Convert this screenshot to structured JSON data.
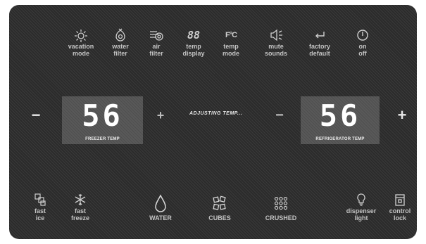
{
  "top_controls": [
    {
      "id": "vacation_mode",
      "lines": [
        "vacation",
        "mode"
      ],
      "icon": "sun-icon"
    },
    {
      "id": "water_filter",
      "lines": [
        "water",
        "filter"
      ],
      "icon": "water-filter-icon"
    },
    {
      "id": "air_filter",
      "lines": [
        "air",
        "filter"
      ],
      "icon": "air-filter-icon"
    },
    {
      "id": "temp_display",
      "lines": [
        "temp",
        "display"
      ],
      "icon": "88"
    },
    {
      "id": "temp_mode",
      "lines": [
        "temp",
        "mode"
      ],
      "icon": "F°C"
    },
    {
      "id": "mute_sounds",
      "lines": [
        "mute",
        "sounds"
      ],
      "icon": "speaker-icon"
    },
    {
      "id": "factory_default",
      "lines": [
        "factory",
        "default"
      ],
      "icon": "return-arrow-icon"
    },
    {
      "id": "on_off",
      "lines": [
        "on",
        "off"
      ],
      "icon": "power-icon"
    }
  ],
  "freezer": {
    "minus": "−",
    "plus": "+",
    "temp": "56",
    "caption": "FREEZER TEMP"
  },
  "refrigerator": {
    "minus": "−",
    "plus": "+",
    "temp": "56",
    "caption": "REFRIGERATOR TEMP"
  },
  "status_text": "ADJUSTING TEMP...",
  "bottom_controls": [
    {
      "id": "fast_ice",
      "lines": [
        "fast",
        "ice"
      ],
      "icon": "ice-cubes-icon"
    },
    {
      "id": "fast_freeze",
      "lines": [
        "fast",
        "freeze"
      ],
      "icon": "snowflake-icon"
    },
    {
      "id": "water",
      "lines": [
        "WATER"
      ],
      "icon": "water-drop-icon"
    },
    {
      "id": "cubes",
      "lines": [
        "CUBES"
      ],
      "icon": "cubes-icon"
    },
    {
      "id": "crushed",
      "lines": [
        "CRUSHED"
      ],
      "icon": "crushed-ice-icon"
    },
    {
      "id": "dispenser_light",
      "lines": [
        "dispenser",
        "light"
      ],
      "icon": "bulb-icon"
    },
    {
      "id": "control_lock",
      "lines": [
        "control",
        "lock"
      ],
      "icon": "lock-icon"
    }
  ],
  "colors": {
    "panel": "#2b2b2b",
    "display": "#595959",
    "label": "#c4c4c4",
    "digits": "#ffffff"
  }
}
